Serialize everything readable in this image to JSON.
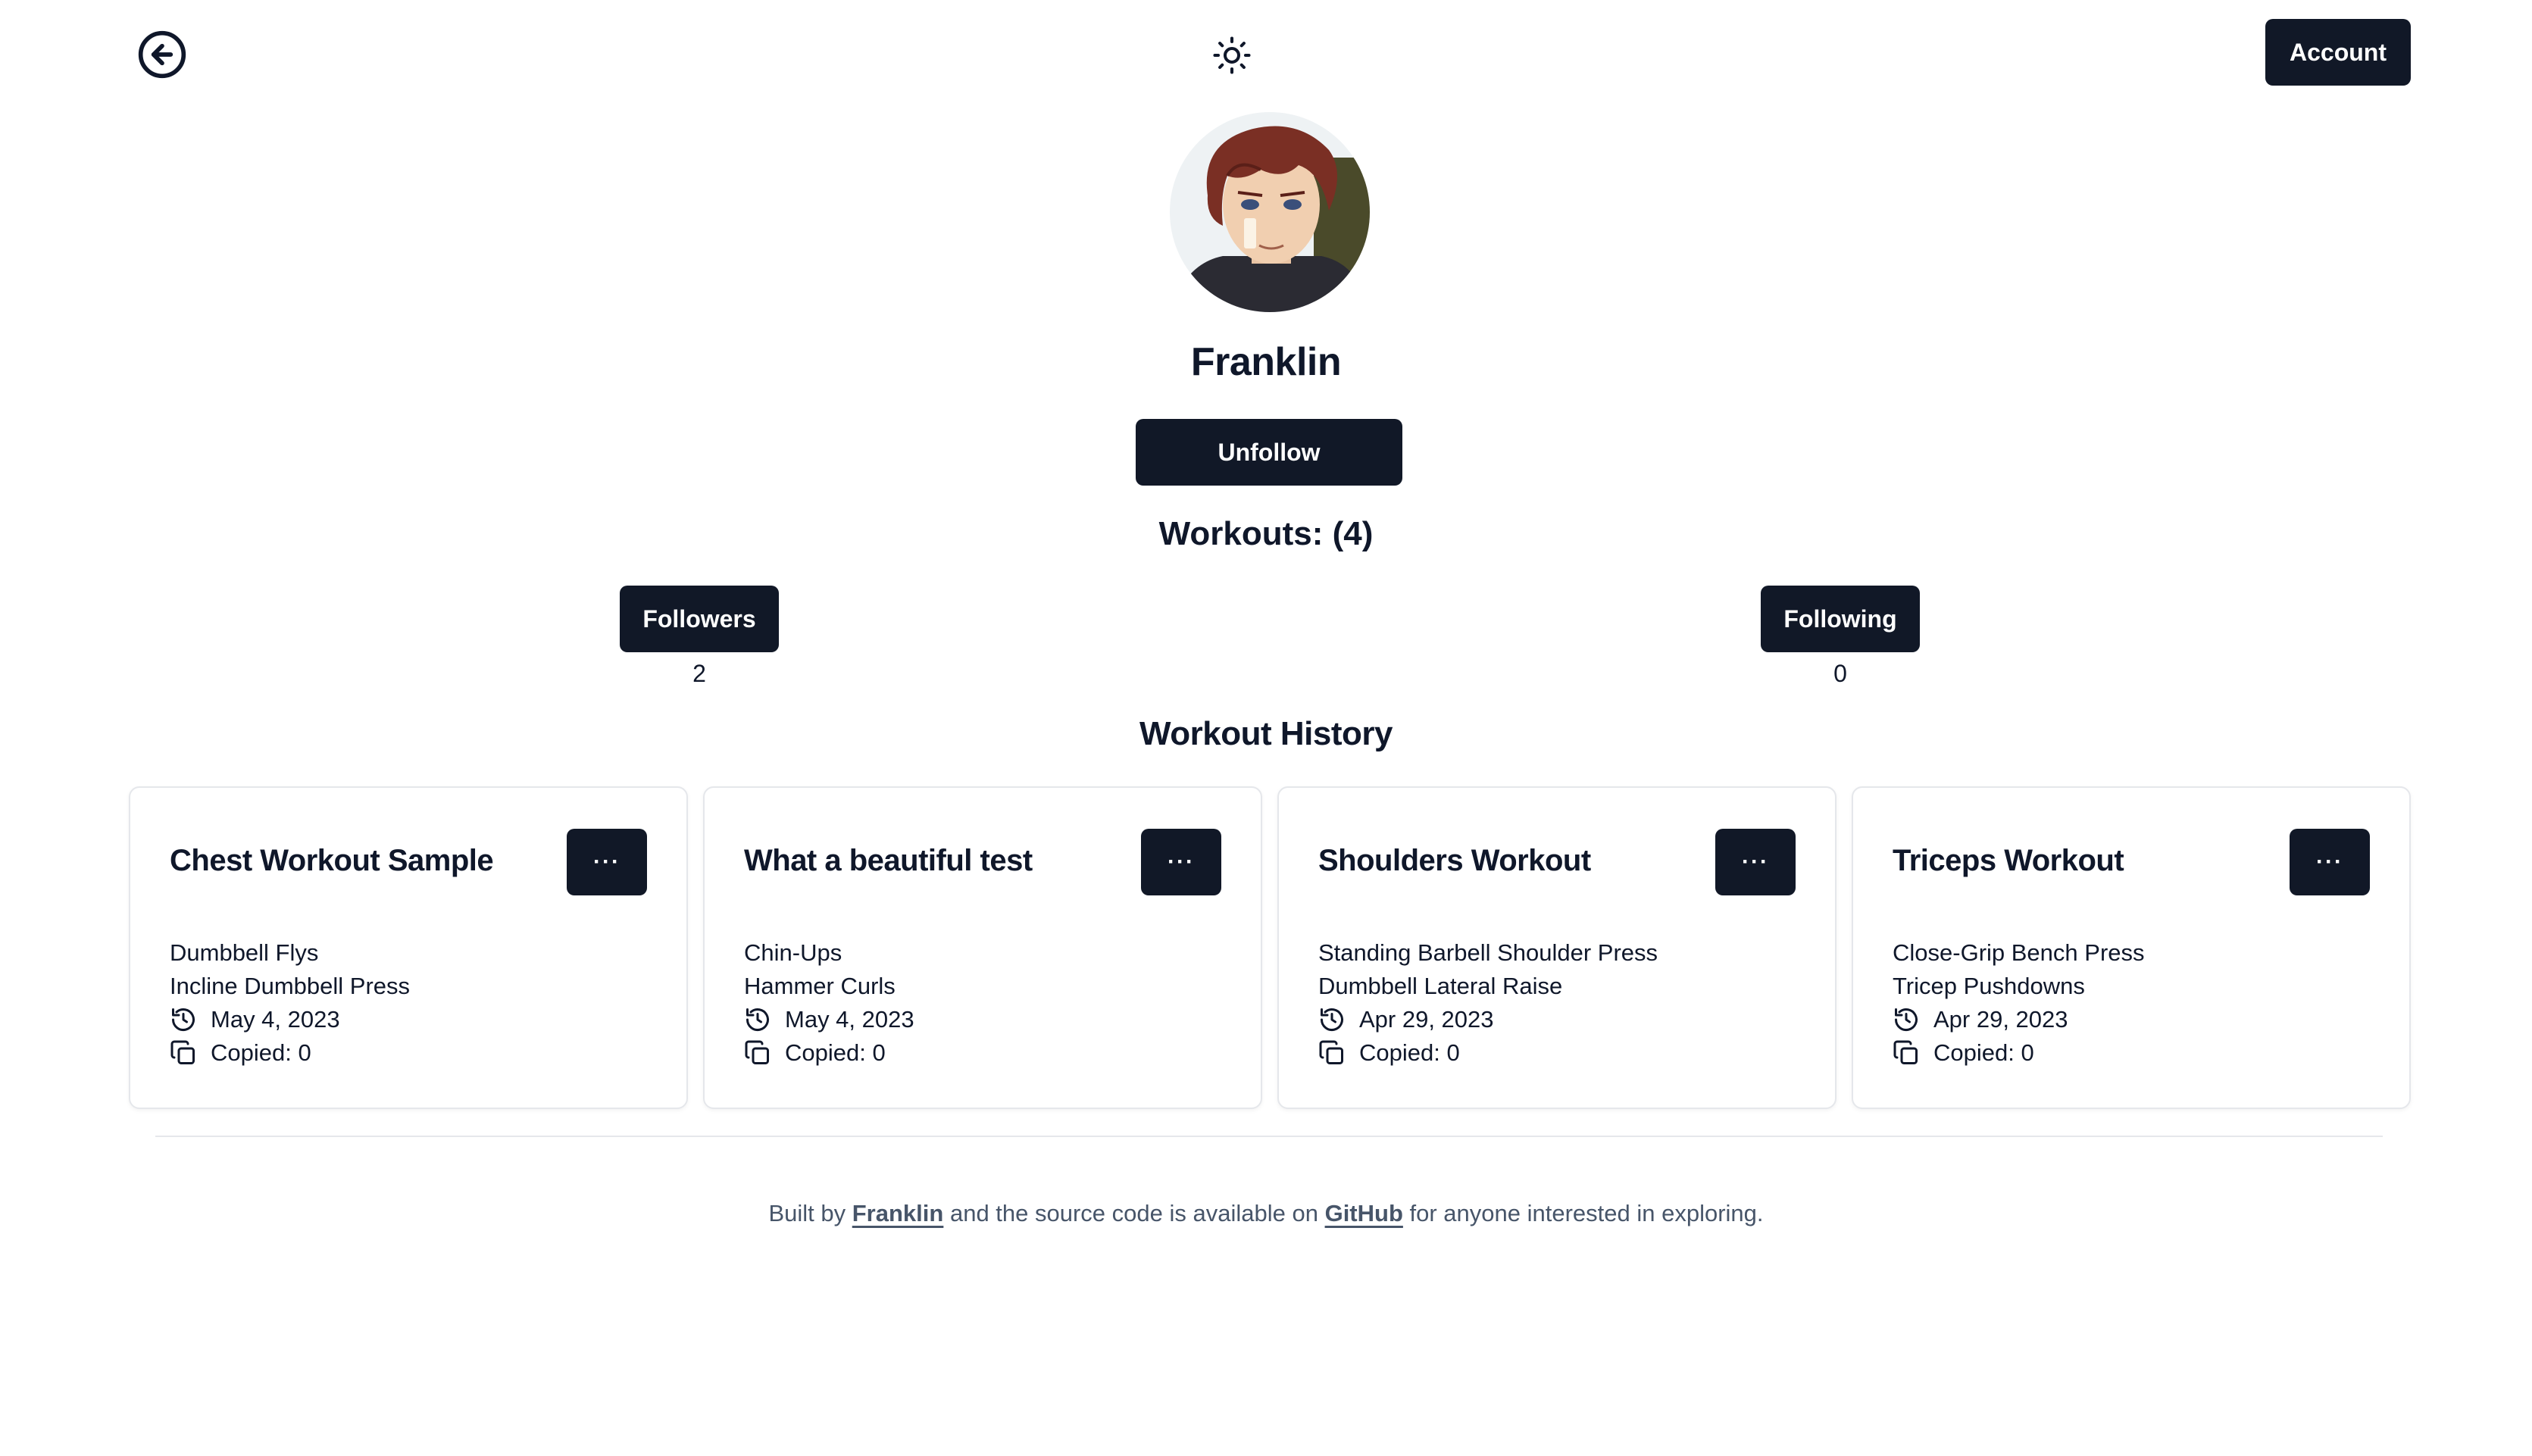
{
  "header": {
    "back_icon": "arrow-left-circle-icon",
    "theme_icon": "sun-icon",
    "account_label": "Account"
  },
  "profile": {
    "name": "Franklin",
    "unfollow_label": "Unfollow",
    "workouts_label": "Workouts: (4)",
    "followers_label": "Followers",
    "followers_count": "2",
    "following_label": "Following",
    "following_count": "0"
  },
  "history": {
    "title": "Workout History",
    "menu_label": "···",
    "cards": [
      {
        "title": "Chest Workout Sample",
        "exercises": [
          "Dumbbell Flys",
          "Incline Dumbbell Press"
        ],
        "date": "May 4, 2023",
        "copied": "Copied: 0"
      },
      {
        "title": "What a beautiful test",
        "exercises": [
          "Chin-Ups",
          "Hammer Curls"
        ],
        "date": "May 4, 2023",
        "copied": "Copied: 0"
      },
      {
        "title": "Shoulders Workout",
        "exercises": [
          "Standing Barbell Shoulder Press",
          "Dumbbell Lateral Raise"
        ],
        "date": "Apr 29, 2023",
        "copied": "Copied: 0"
      },
      {
        "title": "Triceps Workout",
        "exercises": [
          "Close-Grip Bench Press",
          "Tricep Pushdowns"
        ],
        "date": "Apr 29, 2023",
        "copied": "Copied: 0"
      }
    ]
  },
  "footer": {
    "text_1": "Built by ",
    "link_author": "Franklin",
    "text_2": " and the source code is available on ",
    "link_repo": "GitHub",
    "text_3": " for anyone interested in exploring."
  },
  "colors": {
    "primary": "#111827",
    "text": "#0f172a",
    "muted": "#475569",
    "border": "#e5e7eb"
  }
}
